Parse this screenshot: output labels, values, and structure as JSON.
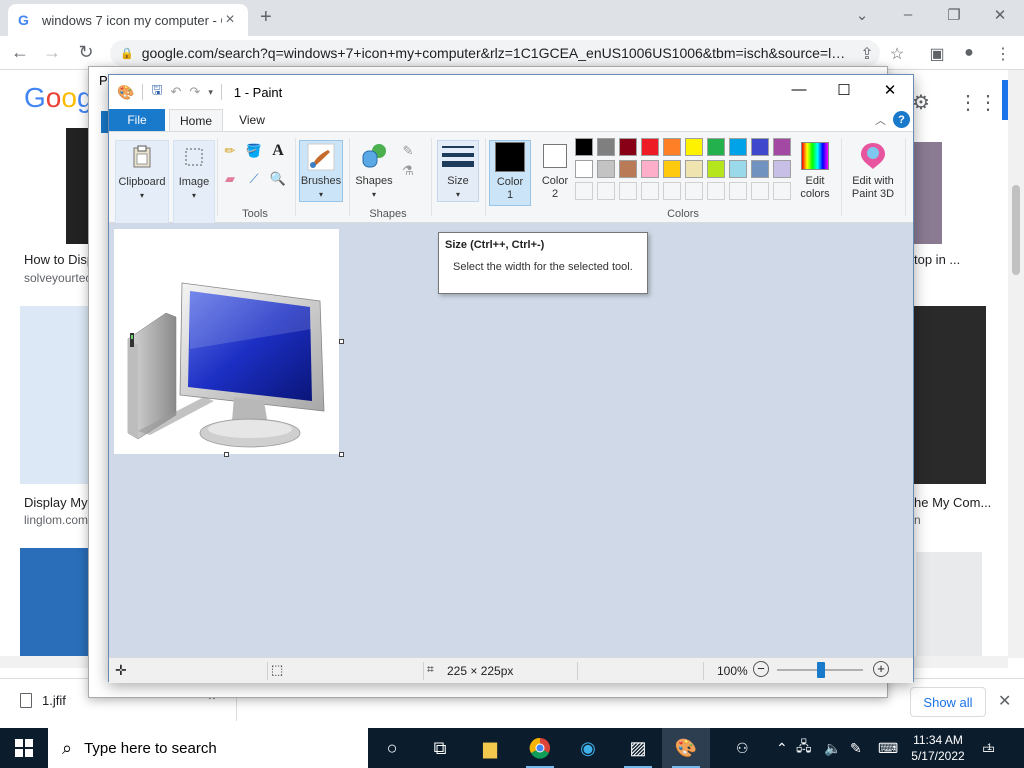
{
  "browser": {
    "tab_title": "windows 7 icon my computer - Google Search",
    "tab_favicon": "G",
    "url": "google.com/search?q=windows+7+icon+my+computer&rlz=1C1GCEA_enUS1006US1006&tbm=isch&source=l…"
  },
  "google": {
    "logo": [
      "G",
      "o",
      "o",
      "g"
    ],
    "results": [
      {
        "title": "How to Disp",
        "source": "solveyourtec"
      },
      {
        "title": "Display My",
        "source": "linglom.com"
      },
      {
        "title": "top in ...",
        "source": ""
      },
      {
        "title": "he My Com...",
        "source": "n"
      }
    ]
  },
  "download": {
    "file_name": "1.jfif",
    "show_all": "Show all"
  },
  "taskbar": {
    "search_placeholder": "Type here to search",
    "time": "11:34 AM",
    "date": "5/17/2022",
    "notification_count": "1"
  },
  "paint": {
    "window_title": "1 - Paint",
    "behind_title_char": "Pl",
    "tabs": {
      "file": "File",
      "home": "Home",
      "view": "View"
    },
    "ribbon": {
      "clipboard": "Clipboard",
      "image": "Image",
      "tools_label": "Tools",
      "brushes": "Brushes",
      "shapes": "Shapes",
      "shapes_label": "Shapes",
      "size": "Size",
      "color1": "Color\n1",
      "color1_a": "Color",
      "color1_b": "1",
      "color2_a": "Color",
      "color2_b": "2",
      "edit_colors_a": "Edit",
      "edit_colors_b": "colors",
      "paint3d_a": "Edit with",
      "paint3d_b": "Paint 3D",
      "colors_label": "Colors"
    },
    "palette_row1": [
      "#000000",
      "#7f7f7f",
      "#880015",
      "#ed1c24",
      "#ff7f27",
      "#fff200",
      "#22b14c",
      "#00a2e8",
      "#3f48cc",
      "#a349a4"
    ],
    "palette_row2": [
      "#ffffff",
      "#c3c3c3",
      "#b97a57",
      "#ffaec9",
      "#ffc90e",
      "#efe4b0",
      "#b5e61d",
      "#99d9ea",
      "#7092be",
      "#c8bfe7"
    ],
    "color1_value": "#000000",
    "color2_value": "#ffffff",
    "tooltip": {
      "title": "Size (Ctrl++, Ctrl+-)",
      "body": "Select the width for the selected tool."
    },
    "status": {
      "dimensions": "225 × 225px",
      "zoom": "100%"
    }
  }
}
